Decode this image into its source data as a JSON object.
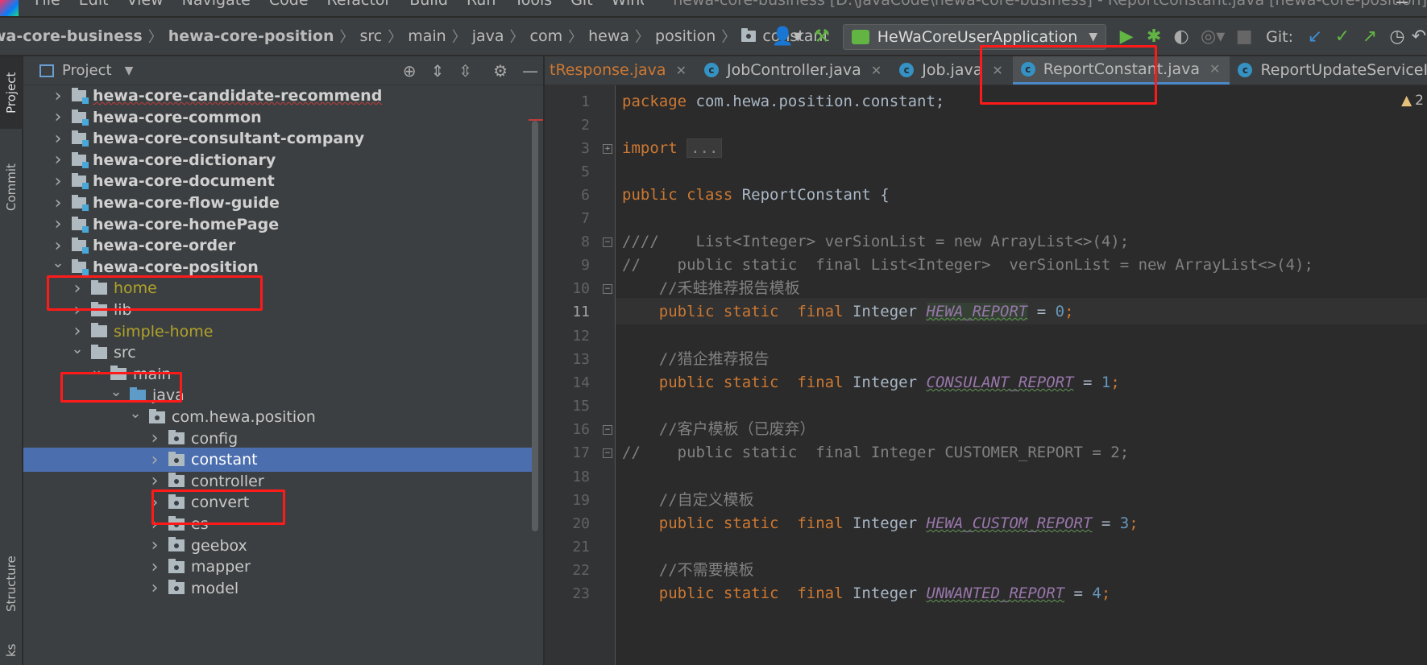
{
  "menubar": {
    "items": [
      "File",
      "Edit",
      "View",
      "Navigate",
      "Code",
      "Refactor",
      "Build",
      "Run",
      "Tools",
      "Git",
      "Window",
      "Help"
    ],
    "window_title": "hewa-core-business [D:\\JavaCode\\hewa-core-business] - ReportConstant.java [hewa-core-position]"
  },
  "breadcrumbs": [
    "wa-core-business",
    "hewa-core-position",
    "src",
    "main",
    "java",
    "com",
    "hewa",
    "position",
    "constant"
  ],
  "toolbar": {
    "run_config": "HeWaCoreUserApplication",
    "git_label": "Git:"
  },
  "side_tabs": {
    "project": "Project",
    "commit": "Commit",
    "structure": "Structure",
    "bookmarks": "ks"
  },
  "project_panel": {
    "title": "Project",
    "tree": [
      {
        "label": "hewa-core-candidate-recommend",
        "style": "module",
        "arrow": "›"
      },
      {
        "label": "hewa-core-common",
        "style": "module",
        "arrow": "›"
      },
      {
        "label": "hewa-core-consultant-company",
        "style": "module",
        "arrow": "›"
      },
      {
        "label": "hewa-core-dictionary",
        "style": "module",
        "arrow": "›"
      },
      {
        "label": "hewa-core-document",
        "style": "module",
        "arrow": "›"
      },
      {
        "label": "hewa-core-flow-guide",
        "style": "module",
        "arrow": "›"
      },
      {
        "label": "hewa-core-homePage",
        "style": "module",
        "arrow": "›"
      },
      {
        "label": "hewa-core-order",
        "style": "module",
        "arrow": "›"
      },
      {
        "label": "hewa-core-position",
        "style": "module",
        "arrow": "⌄"
      },
      {
        "label": "home",
        "style": "yellow",
        "arrow": "›"
      },
      {
        "label": "lib",
        "style": "folder",
        "arrow": "›"
      },
      {
        "label": "simple-home",
        "style": "yellow",
        "arrow": "›"
      },
      {
        "label": "src",
        "style": "folder",
        "arrow": "⌄"
      },
      {
        "label": "main",
        "style": "folder",
        "arrow": "⌄"
      },
      {
        "label": "java",
        "style": "blue",
        "arrow": "⌄"
      },
      {
        "label": "com.hewa.position",
        "style": "pkg",
        "arrow": "⌄"
      },
      {
        "label": "config",
        "style": "pkg",
        "arrow": "›"
      },
      {
        "label": "constant",
        "style": "pkg",
        "arrow": "›"
      },
      {
        "label": "controller",
        "style": "pkg",
        "arrow": "›"
      },
      {
        "label": "convert",
        "style": "pkg",
        "arrow": "›"
      },
      {
        "label": "es",
        "style": "pkg",
        "arrow": "›"
      },
      {
        "label": "geebox",
        "style": "pkg",
        "arrow": "›"
      },
      {
        "label": "mapper",
        "style": "pkg",
        "arrow": "›"
      },
      {
        "label": "model",
        "style": "pkg",
        "arrow": "›"
      }
    ]
  },
  "editor": {
    "tabs": [
      {
        "name": "tResponse.java",
        "orange": true
      },
      {
        "name": "JobController.java"
      },
      {
        "name": "Job.java"
      },
      {
        "name": "ReportConstant.java",
        "active": true
      },
      {
        "name": "ReportUpdateServiceImpl.java"
      }
    ],
    "warning_count": "2",
    "line_numbers": [
      "1",
      "2",
      "3",
      "5",
      "6",
      "7",
      "8",
      "9",
      "10",
      "11",
      "12",
      "13",
      "14",
      "15",
      "16",
      "17",
      "18",
      "19",
      "20",
      "21",
      "22",
      "23"
    ],
    "current_line": "11",
    "code_lines": {
      "l1_kw": "package",
      "l1_rest": " com.hewa.position.constant;",
      "l3_kw": "import",
      "l3_collapsed": "...",
      "l6_kw": "public class",
      "l6_rest": " ReportConstant {",
      "l8": "////    List<Integer> verSionList = new ArrayList<>(4);",
      "l9": "//    public static  final List<Integer>  verSionList = new ArrayList<>(4);",
      "l10": "    //禾蛙推荐报告模板",
      "l11_kw": "    public static  final",
      "l11_type": " Integer ",
      "l11_const": "HEWA_REPORT",
      "l11_eq": " = ",
      "l11_num": "0",
      "l11_end": ";",
      "l13": "    //猎企推荐报告",
      "l14_kw": "    public static  final",
      "l14_type": " Integer ",
      "l14_const": "CONSULANT_REPORT",
      "l14_eq": " = ",
      "l14_num": "1",
      "l14_end": ";",
      "l16": "    //客户模板（已废弃）",
      "l17": "//    public static  final Integer CUSTOMER_REPORT = 2;",
      "l19": "    //自定义模板",
      "l20_kw": "    public static  final",
      "l20_type": " Integer ",
      "l20_const": "HEWA_CUSTOM_REPORT",
      "l20_eq": " = ",
      "l20_num": "3",
      "l20_end": ";",
      "l22": "    //不需要模板",
      "l23_kw": "    public static  final",
      "l23_type": " Integer ",
      "l23_const": "UNWANTED_REPORT",
      "l23_eq": " = ",
      "l23_num": "4",
      "l23_end": ";"
    }
  },
  "colors": {
    "highlight_box": "#ff1a1a",
    "selection": "#4b6eaf"
  }
}
